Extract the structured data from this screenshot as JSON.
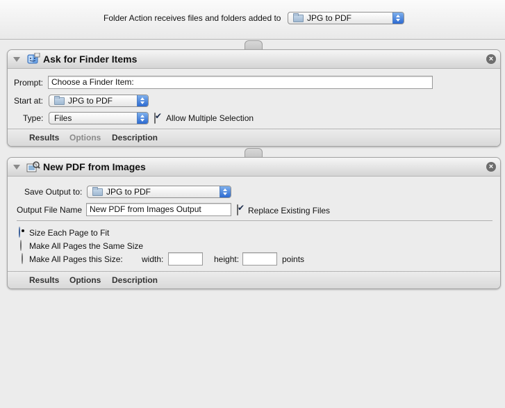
{
  "header": {
    "label": "Folder Action receives files and folders added to",
    "folder_popup": "JPG to PDF"
  },
  "action1": {
    "title": "Ask for Finder Items",
    "prompt_label": "Prompt:",
    "prompt_value": "Choose a Finder Item:",
    "start_label": "Start at:",
    "start_value": "JPG to PDF",
    "type_label": "Type:",
    "type_value": "Files",
    "allow_multiple_label": "Allow Multiple Selection",
    "allow_multiple_checked": true,
    "tabs": {
      "results": "Results",
      "options": "Options",
      "description": "Description"
    }
  },
  "action2": {
    "title": "New PDF from Images",
    "save_label": "Save Output to:",
    "save_value": "JPG to PDF",
    "filename_label": "Output File Name",
    "filename_value": "New PDF from Images Output",
    "replace_label": "Replace Existing Files",
    "replace_checked": true,
    "radio_fit": "Size Each Page to Fit",
    "radio_same": "Make All Pages the Same Size",
    "radio_size": "Make All Pages this Size:",
    "selected_radio": "Size Each Page to Fit",
    "width_label": "width:",
    "width_value": "",
    "height_label": "height:",
    "height_value": "",
    "points_label": "points",
    "tabs": {
      "results": "Results",
      "options": "Options",
      "description": "Description"
    }
  },
  "icons": {
    "disclosure": "disclosure-triangle-icon",
    "close": "close-icon",
    "folder": "folder-icon",
    "finder_action": "finder-action-icon",
    "preview_action": "preview-action-icon"
  }
}
